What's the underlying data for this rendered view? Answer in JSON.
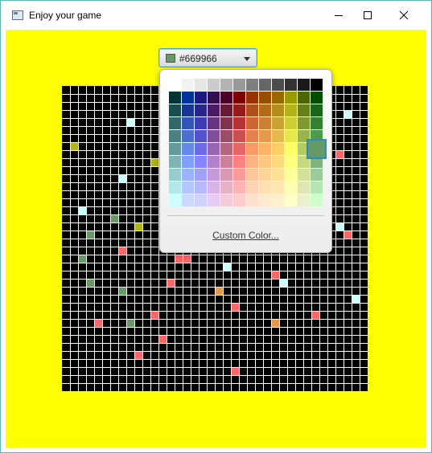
{
  "window": {
    "title": "Enjoy your game"
  },
  "colors": {
    "background": "#ffff00",
    "grid_bg": "#000000",
    "grid_line": "#ffffff",
    "accent": "#2a8fb0"
  },
  "color_picker": {
    "value": "#669966",
    "swatch_color": "#669966"
  },
  "palette": {
    "rows": [
      [
        "#ffffff",
        "#f2f2f2",
        "#e5e5e5",
        "#cccccc",
        "#b2b2b2",
        "#999999",
        "#7f7f7f",
        "#666666",
        "#4c4c4c",
        "#333333",
        "#191919",
        "#000000"
      ],
      [
        "#003333",
        "#003399",
        "#1a1a80",
        "#330d4d",
        "#4d0026",
        "#800000",
        "#993300",
        "#994d00",
        "#996600",
        "#999900",
        "#4d6600",
        "#004d00"
      ],
      [
        "#1a4d4d",
        "#1a3399",
        "#26268c",
        "#4d1a66",
        "#661a33",
        "#991a1a",
        "#b34d1a",
        "#b36b1a",
        "#b38c1a",
        "#b3b31a",
        "#668019",
        "#1a661a"
      ],
      [
        "#336666",
        "#3355b3",
        "#3d3db3",
        "#663380",
        "#80334d",
        "#b33333",
        "#cc6633",
        "#cc8033",
        "#cca333",
        "#cccc33",
        "#809933",
        "#338033"
      ],
      [
        "#4d8080",
        "#4d6ecc",
        "#5252cc",
        "#804d99",
        "#994d66",
        "#cc4d4d",
        "#e67f4d",
        "#e6994d",
        "#e6b84d",
        "#e6e64d",
        "#99b34d",
        "#4d994d"
      ],
      [
        "#669999",
        "#6688e6",
        "#6b6be6",
        "#9966b3",
        "#b36680",
        "#e66666",
        "#ff9966",
        "#ffb366",
        "#ffcc66",
        "#ffff66",
        "#b3cc66",
        "#669966"
      ],
      [
        "#80b3b3",
        "#80a0ff",
        "#8585ff",
        "#b380cc",
        "#cc8099",
        "#ff8080",
        "#ffb380",
        "#ffc680",
        "#ffd980",
        "#ffff80",
        "#c6d980",
        "#80b380"
      ],
      [
        "#99cccc",
        "#99b3ff",
        "#a0a0ff",
        "#c699d9",
        "#d999b3",
        "#ff9999",
        "#ffc699",
        "#ffd399",
        "#ffe099",
        "#ffff99",
        "#d3e099",
        "#99cc99"
      ],
      [
        "#b3e6e6",
        "#b3c6ff",
        "#b8b8ff",
        "#d9b3e6",
        "#e6b3c6",
        "#ffb3b3",
        "#ffd3b3",
        "#ffe0b3",
        "#ffe6b3",
        "#ffffb3",
        "#e0e6b3",
        "#b3e6b3"
      ],
      [
        "#ccffff",
        "#ccd9ff",
        "#d1d1ff",
        "#e6ccf2",
        "#f2ccd9",
        "#ffcccc",
        "#ffe0cc",
        "#ffeacc",
        "#fff0cc",
        "#ffffcc",
        "#eaf0cc",
        "#ccffcc"
      ]
    ],
    "selected": {
      "row": 5,
      "col": 11
    },
    "custom_label": "Custom Color..."
  },
  "grid": {
    "cols": 38,
    "rows": 38,
    "colored_cells": [
      {
        "c": 8,
        "r": 4,
        "color": "#ccffff"
      },
      {
        "c": 35,
        "r": 3,
        "color": "#ccffff"
      },
      {
        "c": 1,
        "r": 7,
        "color": "#b3b31a"
      },
      {
        "c": 11,
        "r": 9,
        "color": "#b3b31a"
      },
      {
        "c": 34,
        "r": 8,
        "color": "#ff6666"
      },
      {
        "c": 7,
        "r": 11,
        "color": "#ccffff"
      },
      {
        "c": 2,
        "r": 15,
        "color": "#ccffff"
      },
      {
        "c": 6,
        "r": 16,
        "color": "#669966"
      },
      {
        "c": 9,
        "r": 17,
        "color": "#b3b31a"
      },
      {
        "c": 34,
        "r": 17,
        "color": "#ccffff"
      },
      {
        "c": 3,
        "r": 18,
        "color": "#669966"
      },
      {
        "c": 35,
        "r": 18,
        "color": "#ff6666"
      },
      {
        "c": 7,
        "r": 20,
        "color": "#ff6666"
      },
      {
        "c": 2,
        "r": 21,
        "color": "#669966"
      },
      {
        "c": 14,
        "r": 21,
        "color": "#ff6666"
      },
      {
        "c": 15,
        "r": 21,
        "color": "#ff6666"
      },
      {
        "c": 20,
        "r": 22,
        "color": "#ccffff"
      },
      {
        "c": 26,
        "r": 23,
        "color": "#ff6666"
      },
      {
        "c": 3,
        "r": 24,
        "color": "#669966"
      },
      {
        "c": 13,
        "r": 24,
        "color": "#ff6666"
      },
      {
        "c": 27,
        "r": 24,
        "color": "#ccffff"
      },
      {
        "c": 7,
        "r": 25,
        "color": "#669966"
      },
      {
        "c": 19,
        "r": 25,
        "color": "#e6994d"
      },
      {
        "c": 36,
        "r": 26,
        "color": "#ccffff"
      },
      {
        "c": 21,
        "r": 27,
        "color": "#ff6666"
      },
      {
        "c": 11,
        "r": 28,
        "color": "#ff6666"
      },
      {
        "c": 31,
        "r": 28,
        "color": "#ff6666"
      },
      {
        "c": 4,
        "r": 29,
        "color": "#ff6666"
      },
      {
        "c": 8,
        "r": 29,
        "color": "#669966"
      },
      {
        "c": 26,
        "r": 29,
        "color": "#e6994d"
      },
      {
        "c": 12,
        "r": 31,
        "color": "#ff6666"
      },
      {
        "c": 9,
        "r": 33,
        "color": "#ff6666"
      },
      {
        "c": 21,
        "r": 35,
        "color": "#ff6666"
      }
    ]
  }
}
